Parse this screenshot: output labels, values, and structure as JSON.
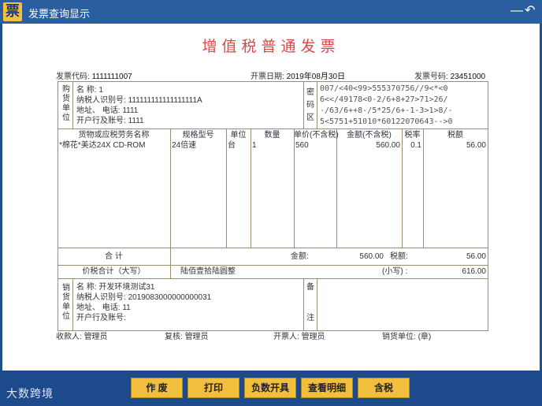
{
  "window": {
    "title": "发票查询显示",
    "logo_char": "票",
    "minimize": "—",
    "back": "↶"
  },
  "invoice": {
    "title": "增值税普通发票",
    "code_label": "发票代码:",
    "code": "1111111007",
    "date_label": "开票日期:",
    "date": "2019年08月30日",
    "number_label": "发票号码:",
    "number": "23451000"
  },
  "buyer": {
    "side_label": [
      "购",
      "货",
      "单",
      "位"
    ],
    "name_label": "名      称:",
    "name": "1",
    "taxid_label": "纳税人识别号:",
    "taxid": "111111111111111111A",
    "addr_label": "地址、  电话:",
    "addr": "1111",
    "bank_label": "开户行及账号:",
    "bank": "1111"
  },
  "cipher": {
    "side_label": [
      "密",
      "码",
      "区"
    ],
    "lines": [
      "007/<40<99>555370756//9<*<0",
      "6<</49178<0-2/6+8+27>71>26/",
      "-/63/6++8-/5*25/6+-1-3>1>8/-",
      "5<5751+51010*60122070643-->0"
    ]
  },
  "items_header": [
    "货物或应税劳务名称",
    "规格型号",
    "单位",
    "数量",
    "单价(不含税)",
    "金额(不含税)",
    "税率",
    "税额"
  ],
  "items": [
    {
      "name": "*棉花*美达24X CD-ROM",
      "spec": "24倍速",
      "unit": "台",
      "qty": "1",
      "price": "560",
      "amount": "560.00",
      "rate": "0.1",
      "tax": "56.00"
    }
  ],
  "totals": {
    "label": "合    计",
    "amount_label": "金额:",
    "amount": "560.00",
    "tax_label": "税额:",
    "tax": "56.00",
    "cap_label": "价税合计（大写）",
    "cap_value": "陆佰壹拾陆圆整",
    "small_label": "(小写)  :",
    "small_value": "616.00"
  },
  "seller": {
    "side_label": [
      "销",
      "货",
      "单",
      "位"
    ],
    "name_label": "名      称:",
    "name": "开发环境测试31",
    "taxid_label": "纳税人识别号:",
    "taxid": "2019083000000000031",
    "addr_label": "地址、  电话:",
    "addr": "11",
    "bank_label": "开户行及账号:",
    "bank": "",
    "remark_label": [
      "备",
      "注"
    ]
  },
  "signatures": {
    "payee_label": "收款人:",
    "payee": "管理员",
    "reviewer_label": "复核:",
    "reviewer": "管理员",
    "drawer_label": "开票人:",
    "drawer": "管理员",
    "seller_label": "销货单位:",
    "seller": "(章)"
  },
  "brand": "大数跨境",
  "buttons": [
    "作 废",
    "打印",
    "负数开具",
    "查看明细",
    "含税"
  ]
}
